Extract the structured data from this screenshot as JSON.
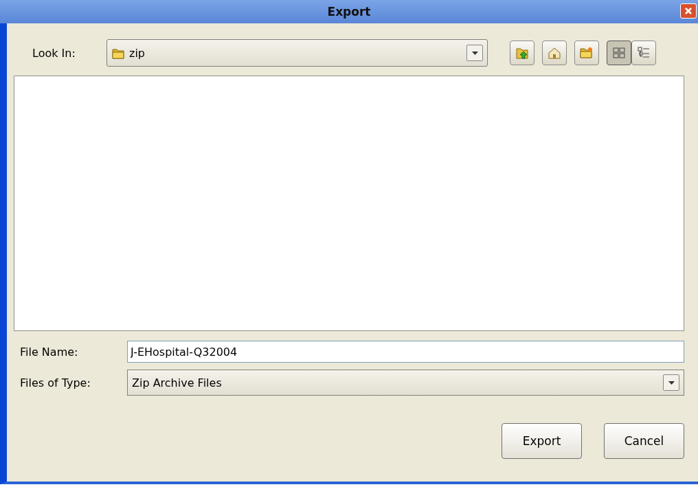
{
  "window": {
    "title": "Export"
  },
  "look_in": {
    "label": "Look In:",
    "value": "zip"
  },
  "toolbar": [
    {
      "kind": "up",
      "pressed": false
    },
    {
      "kind": "home",
      "pressed": false
    },
    {
      "kind": "new-folder",
      "pressed": false
    },
    {
      "kind": "list",
      "pressed": true
    },
    {
      "kind": "details",
      "pressed": false
    }
  ],
  "file_name": {
    "label": "File Name:",
    "value": "J-EHospital-Q32004"
  },
  "file_type": {
    "label": "Files of Type:",
    "value": "Zip Archive Files"
  },
  "buttons": [
    "Export",
    "Cancel"
  ]
}
